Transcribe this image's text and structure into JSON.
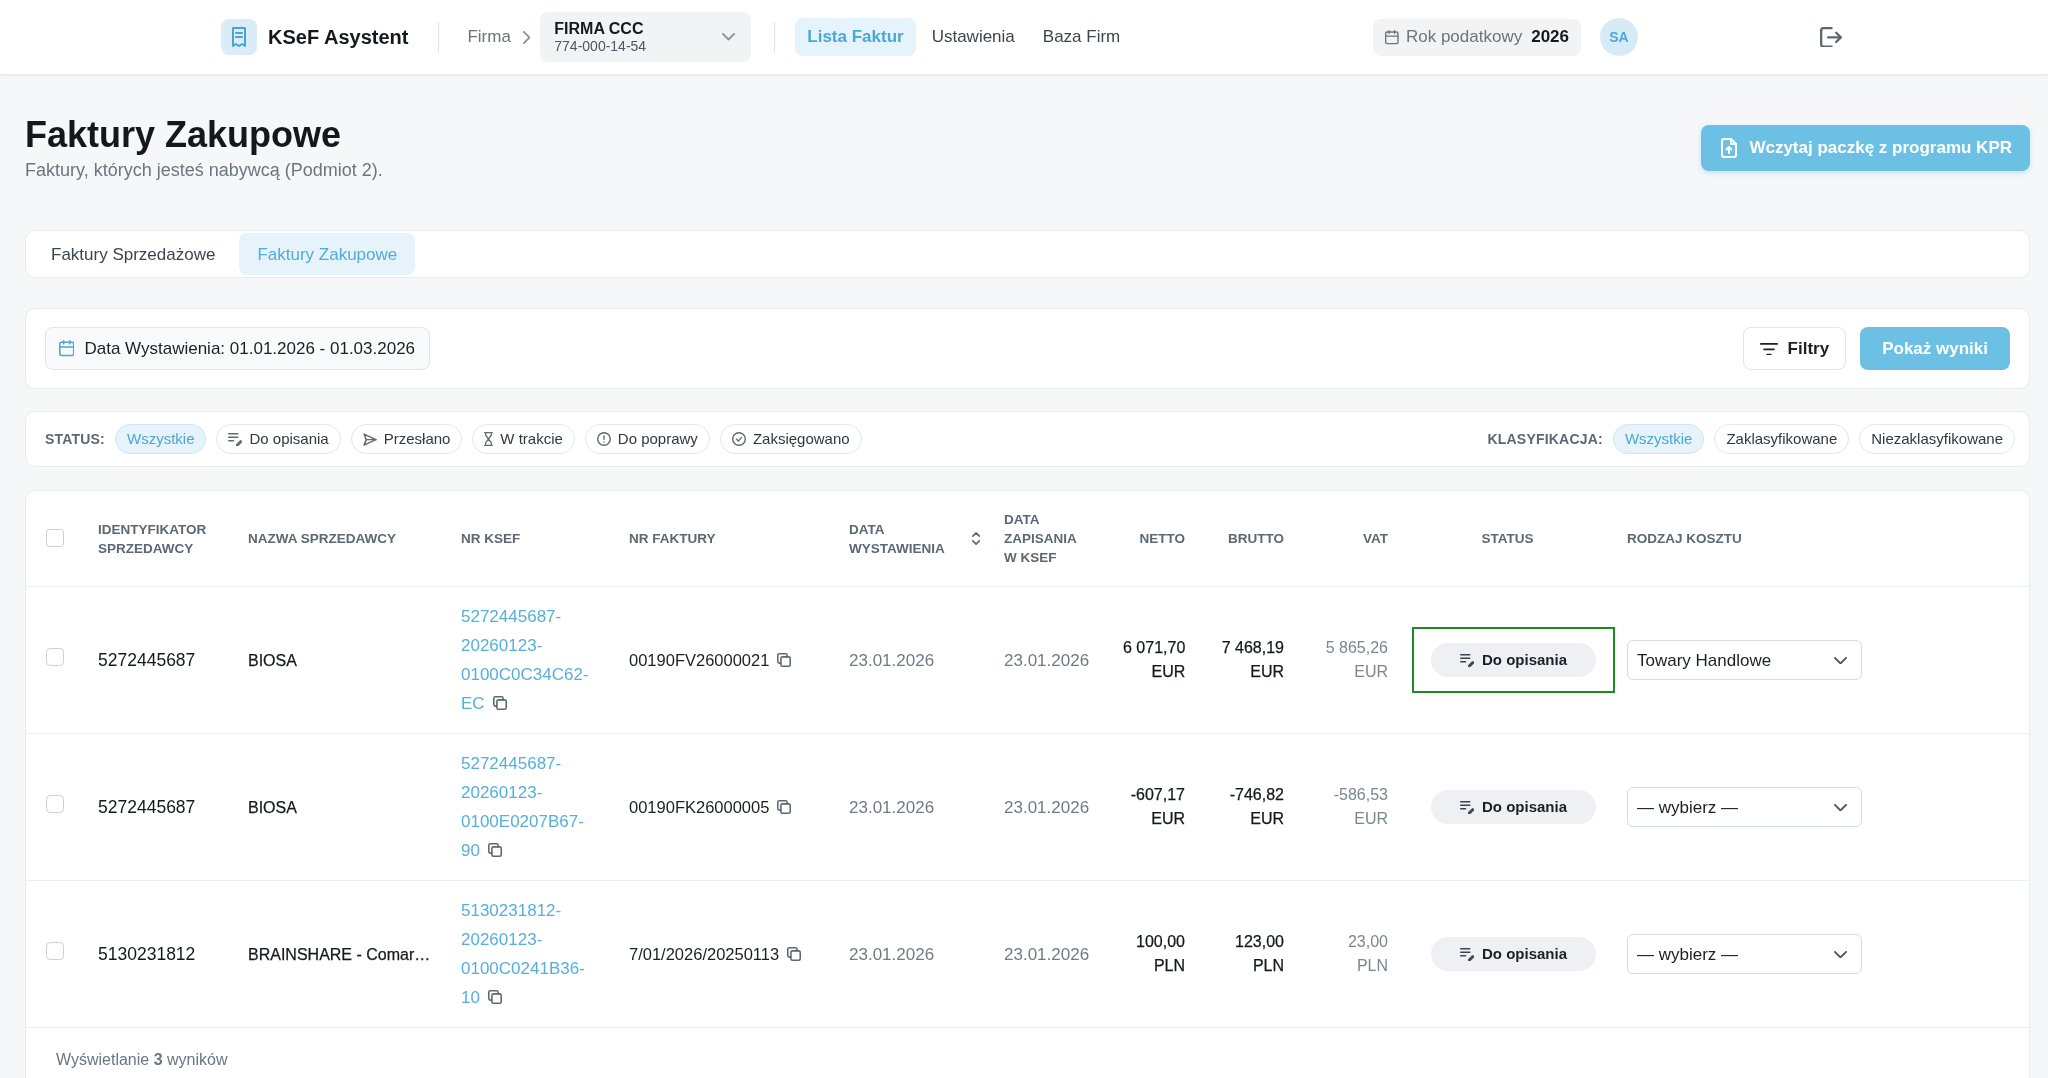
{
  "navbar": {
    "app_name": "KSeF Asystent",
    "company_label": "Firma",
    "company": {
      "name": "FIRMA CCC",
      "tax_id": "774-000-14-54"
    },
    "links": [
      {
        "label": "Lista Faktur",
        "selected": true
      },
      {
        "label": "Ustawienia",
        "selected": false
      },
      {
        "label": "Baza Firm",
        "selected": false
      }
    ],
    "tax_year": {
      "label": "Rok podatkowy",
      "value": "2026"
    },
    "user_initials": "SA"
  },
  "page": {
    "title": "Faktury Zakupowe",
    "subtitle": "Faktury, których jesteś nabywcą (Podmiot 2).",
    "import_button": "Wczytaj paczkę z programu KPR"
  },
  "tabs": [
    {
      "label": "Faktury Sprzedażowe",
      "selected": false
    },
    {
      "label": "Faktury Zakupowe",
      "selected": true
    }
  ],
  "filters": {
    "date_range": "Data Wystawienia: 01.01.2026 - 01.03.2026",
    "filters_button": "Filtry",
    "show_results_button": "Pokaż wyniki"
  },
  "status_filter": {
    "label": "STATUS:",
    "options": [
      {
        "label": "Wszystkie",
        "kind": "all",
        "selected": true
      },
      {
        "label": "Do opisania",
        "kind": "to-describe",
        "selected": false
      },
      {
        "label": "Przesłano",
        "kind": "sent",
        "selected": false
      },
      {
        "label": "W trakcie",
        "kind": "in-progress",
        "selected": false
      },
      {
        "label": "Do poprawy",
        "kind": "to-fix",
        "selected": false
      },
      {
        "label": "Zaksięgowano",
        "kind": "booked",
        "selected": false
      }
    ]
  },
  "classification_filter": {
    "label": "KLASYFIKACJA:",
    "options": [
      {
        "label": "Wszystkie",
        "selected": true
      },
      {
        "label": "Zaklasyfikowane",
        "selected": false
      },
      {
        "label": "Niezaklasyfikowane",
        "selected": false
      }
    ]
  },
  "table": {
    "select_all_checked": false,
    "columns": [
      {
        "label": "IDENTYFIKATOR SPRZEDAWCY",
        "sortable": false
      },
      {
        "label": "NAZWA SPRZEDAWCY",
        "sortable": false
      },
      {
        "label": "NR KSEF",
        "sortable": false
      },
      {
        "label": "NR FAKTURY",
        "sortable": false
      },
      {
        "label": "DATA WYSTAWIENIA",
        "sortable": true
      },
      {
        "label": "DATA ZAPISANIA W KSEF",
        "sortable": false
      },
      {
        "label": "NETTO",
        "sortable": false
      },
      {
        "label": "BRUTTO",
        "sortable": false
      },
      {
        "label": "VAT",
        "sortable": false
      },
      {
        "label": "STATUS",
        "sortable": false
      },
      {
        "label": "RODZAJ KOSZTU",
        "sortable": false
      }
    ],
    "rows": [
      {
        "checked": false,
        "seller_id": "5272445687",
        "seller_name": "BIOSA",
        "ksef_number": "5272445687-20260123-0100C0C34C62-EC",
        "invoice_number": "00190FV26000021",
        "issue_date": "23.01.2026",
        "saved_date": "23.01.2026",
        "net": {
          "amount": "6 071,70",
          "currency": "EUR"
        },
        "gross": {
          "amount": "7 468,19",
          "currency": "EUR"
        },
        "vat": {
          "amount": "5 865,26",
          "currency": "EUR"
        },
        "status": {
          "label": "Do opisania",
          "kind": "to-describe",
          "focused": true
        },
        "cost_type": "Towary Handlowe"
      },
      {
        "checked": false,
        "seller_id": "5272445687",
        "seller_name": "BIOSA",
        "ksef_number": "5272445687-20260123-0100E0207B67-90",
        "invoice_number": "00190FK26000005",
        "issue_date": "23.01.2026",
        "saved_date": "23.01.2026",
        "net": {
          "amount": "-607,17",
          "currency": "EUR"
        },
        "gross": {
          "amount": "-746,82",
          "currency": "EUR"
        },
        "vat": {
          "amount": "-586,53",
          "currency": "EUR"
        },
        "status": {
          "label": "Do opisania",
          "kind": "to-describe",
          "focused": false
        },
        "cost_type": "— wybierz —"
      },
      {
        "checked": false,
        "seller_id": "5130231812",
        "seller_name": "BRAINSHARE - Comar…",
        "ksef_number": "5130231812-20260123-0100C0241B36-10",
        "invoice_number": "7/01/2026/20250113",
        "issue_date": "23.01.2026",
        "saved_date": "23.01.2026",
        "net": {
          "amount": "100,00",
          "currency": "PLN"
        },
        "gross": {
          "amount": "123,00",
          "currency": "PLN"
        },
        "vat": {
          "amount": "23,00",
          "currency": "PLN"
        },
        "status": {
          "label": "Do opisania",
          "kind": "to-describe",
          "focused": false
        },
        "cost_type": "— wybierz —"
      }
    ],
    "summary": "Wyświetlanie **3** wyników"
  }
}
